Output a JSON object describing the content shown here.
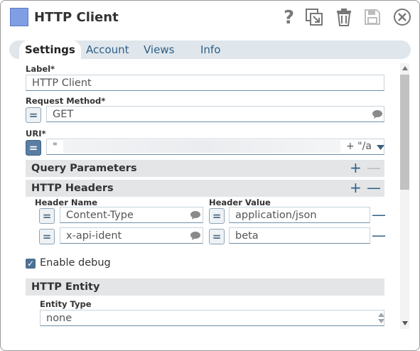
{
  "header": {
    "title": "HTTP Client",
    "swatch_color": "#7f9ee3",
    "icons": [
      "help-icon",
      "copy-icon",
      "trash-icon",
      "save-icon",
      "close-icon"
    ]
  },
  "tabs": [
    {
      "label": "Settings"
    },
    {
      "label": "Account"
    },
    {
      "label": "Views"
    },
    {
      "label": "Info"
    }
  ],
  "form": {
    "label": {
      "title": "Label*",
      "value": "HTTP Client"
    },
    "request_method": {
      "title": "Request Method*",
      "value": "GET",
      "eq": "="
    },
    "uri": {
      "title": "URI*",
      "value_start": "\"",
      "value_end": "+ \"/a",
      "eq": "="
    },
    "query_parameters": {
      "title": "Query Parameters"
    },
    "http_headers": {
      "title": "HTTP Headers",
      "col_name": "Header Name",
      "col_value": "Header Value",
      "rows": [
        {
          "name": "Content-Type",
          "value": "application/json"
        },
        {
          "name": "x-api-ident",
          "value": "beta"
        }
      ]
    },
    "enable_debug": {
      "label": "Enable debug",
      "checked": true
    },
    "http_entity": {
      "title": "HTTP Entity",
      "entity_type_label": "Entity Type",
      "entity_type_value": "none"
    }
  },
  "symbols": {
    "eq": "=",
    "plus": "+",
    "minus": "—",
    "check": "✓"
  },
  "colors": {
    "accent": "#2f5f86",
    "section_bg": "#e3e5e7",
    "disabled": "#b5bcc2"
  }
}
